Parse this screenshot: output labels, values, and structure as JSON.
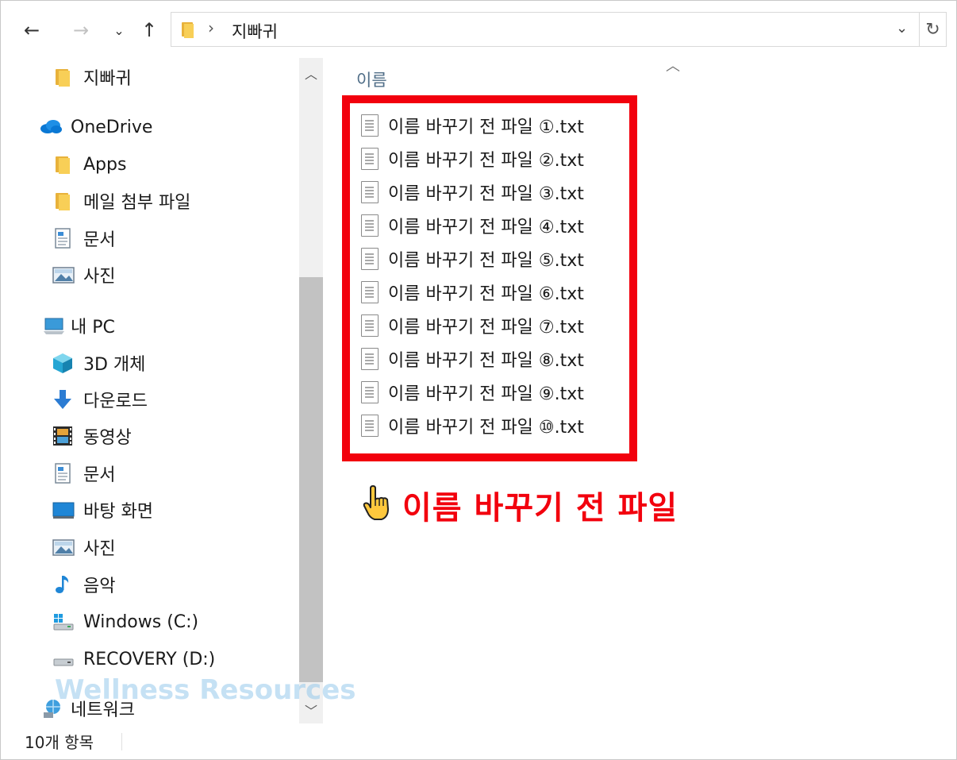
{
  "address": {
    "back_icon": "arrow-left-icon",
    "forward_icon": "arrow-right-icon",
    "recent_icon": "chevron-down-icon",
    "up_icon": "arrow-up-icon",
    "path_label": "지빠귀",
    "dropdown_glyph": "⌄",
    "refresh_glyph": "↻"
  },
  "sidebar": {
    "items": [
      {
        "label": "지빠귀",
        "icon": "folder-icon"
      },
      {
        "label": "OneDrive",
        "icon": "cloud-icon"
      },
      {
        "label": "Apps",
        "icon": "folder-icon"
      },
      {
        "label": "메일 첨부 파일",
        "icon": "folder-icon"
      },
      {
        "label": "문서",
        "icon": "document-icon"
      },
      {
        "label": "사진",
        "icon": "picture-icon"
      },
      {
        "label": "내 PC",
        "icon": "computer-icon"
      },
      {
        "label": "3D 개체",
        "icon": "cube-icon"
      },
      {
        "label": "다운로드",
        "icon": "download-icon"
      },
      {
        "label": "동영상",
        "icon": "film-icon"
      },
      {
        "label": "문서",
        "icon": "document-icon"
      },
      {
        "label": "바탕 화면",
        "icon": "desktop-icon"
      },
      {
        "label": "사진",
        "icon": "picture-icon"
      },
      {
        "label": "음악",
        "icon": "music-note-icon"
      },
      {
        "label": "Windows (C:)",
        "icon": "windows-drive-icon"
      },
      {
        "label": "RECOVERY (D:)",
        "icon": "drive-icon"
      },
      {
        "label": "네트워크",
        "icon": "network-icon"
      }
    ]
  },
  "main": {
    "column_header": "이름",
    "files": [
      "이름 바꾸기 전 파일 ①.txt",
      "이름 바꾸기 전 파일 ②.txt",
      "이름 바꾸기 전 파일 ③.txt",
      "이름 바꾸기 전 파일 ④.txt",
      "이름 바꾸기 전 파일 ⑤.txt",
      "이름 바꾸기 전 파일 ⑥.txt",
      "이름 바꾸기 전 파일 ⑦.txt",
      "이름 바꾸기 전 파일 ⑧.txt",
      "이름 바꾸기 전 파일 ⑨.txt",
      "이름 바꾸기 전 파일 ⑩.txt"
    ]
  },
  "annotation": {
    "pointer_icon": "pointing-hand-icon",
    "text": "이름 바꾸기 전 파일",
    "color": "#f2000d"
  },
  "watermark": "Wellness Resources",
  "status": {
    "item_count": "10개 항목"
  },
  "colors": {
    "folder": "#f8cf57",
    "highlight_red": "#f2000d",
    "column_header": "#4f6d87",
    "scroll_thumb": "#c2c2c2"
  }
}
